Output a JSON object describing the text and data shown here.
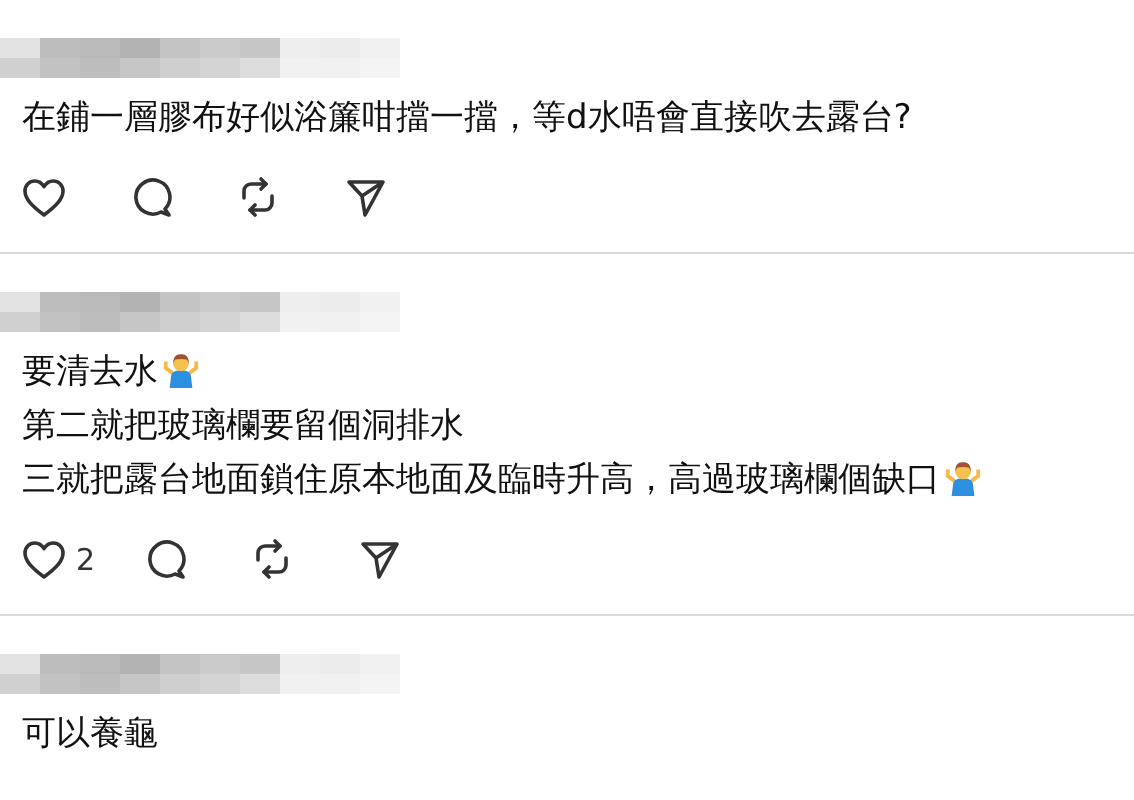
{
  "comments": [
    {
      "lines": [
        {
          "text": "在鋪一層膠布好似浴簾咁擋一擋，等d水唔會直接吹去露台?"
        }
      ],
      "has_actions": true
    },
    {
      "lines": [
        {
          "text": "要清去水",
          "shrug_emoji": true
        },
        {
          "text": "第二就把玻璃欄要留個洞排水"
        },
        {
          "text": "三就把露台地面鎖住原本地面及臨時升高，高過玻璃欄個缺口",
          "shrug_emoji": true
        }
      ],
      "has_actions": true,
      "like_count": "2"
    },
    {
      "lines": [
        {
          "text": "可以養龜"
        }
      ]
    }
  ]
}
